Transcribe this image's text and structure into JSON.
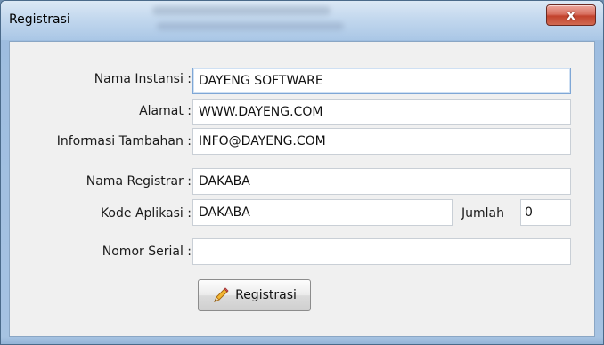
{
  "window": {
    "title": "Registrasi",
    "close_label": "x"
  },
  "form": {
    "nama_instansi": {
      "label": "Nama Instansi :",
      "value": "DAYENG SOFTWARE"
    },
    "alamat": {
      "label": "Alamat :",
      "value": "WWW.DAYENG.COM"
    },
    "informasi_tambahan": {
      "label": "Informasi Tambahan :",
      "value": "INFO@DAYENG.COM"
    },
    "nama_registrar": {
      "label": "Nama Registrar :",
      "value": "DAKABA"
    },
    "kode_aplikasi": {
      "label": "Kode Aplikasi :",
      "value": "DAKABA"
    },
    "jumlah": {
      "label": "Jumlah",
      "value": "0"
    },
    "nomor_serial": {
      "label": "Nomor Serial :",
      "value": ""
    }
  },
  "buttons": {
    "registrasi_label": "Registrasi",
    "registrasi_icon": "pencil-icon"
  },
  "colors": {
    "close_button": "#c7432d",
    "titlebar": "#c3d8ee"
  }
}
